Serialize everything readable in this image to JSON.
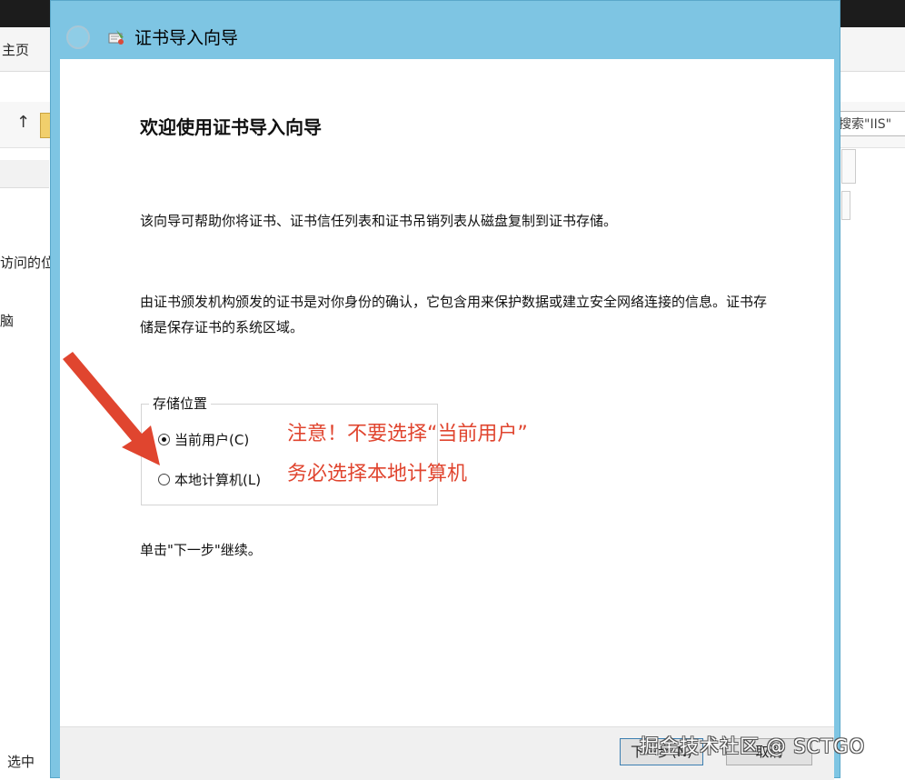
{
  "background_window": {
    "ribbon_tab": "主页",
    "search_placeholder": "搜索\"IIS\"",
    "nav_item_1": "访问的位",
    "nav_item_2": "脑",
    "status_text": "选中",
    "up_arrow_icon": "arrow-up-icon"
  },
  "dialog": {
    "title": "证书导入向导",
    "heading": "欢迎使用证书导入向导",
    "intro": "该向导可帮助你将证书、证书信任列表和证书吊销列表从磁盘复制到证书存储。",
    "description": "由证书颁发机构颁发的证书是对你身份的确认，它包含用来保护数据或建立安全网络连接的信息。证书存储是保存证书的系统区域。",
    "store_location": {
      "legend": "存储位置",
      "options": [
        {
          "label": "当前用户(C)",
          "selected": true
        },
        {
          "label": "本地计算机(L)",
          "selected": false
        }
      ]
    },
    "continue_hint": "单击\"下一步\"继续。",
    "buttons": {
      "next": "下一步(N)",
      "cancel": "取消"
    }
  },
  "annotations": {
    "line1": "注意！不要选择“当前用户”",
    "line2": "务必选择本地计算机",
    "color": "#e0452f"
  },
  "watermark": "掘金技术社区 @ SCTGO"
}
